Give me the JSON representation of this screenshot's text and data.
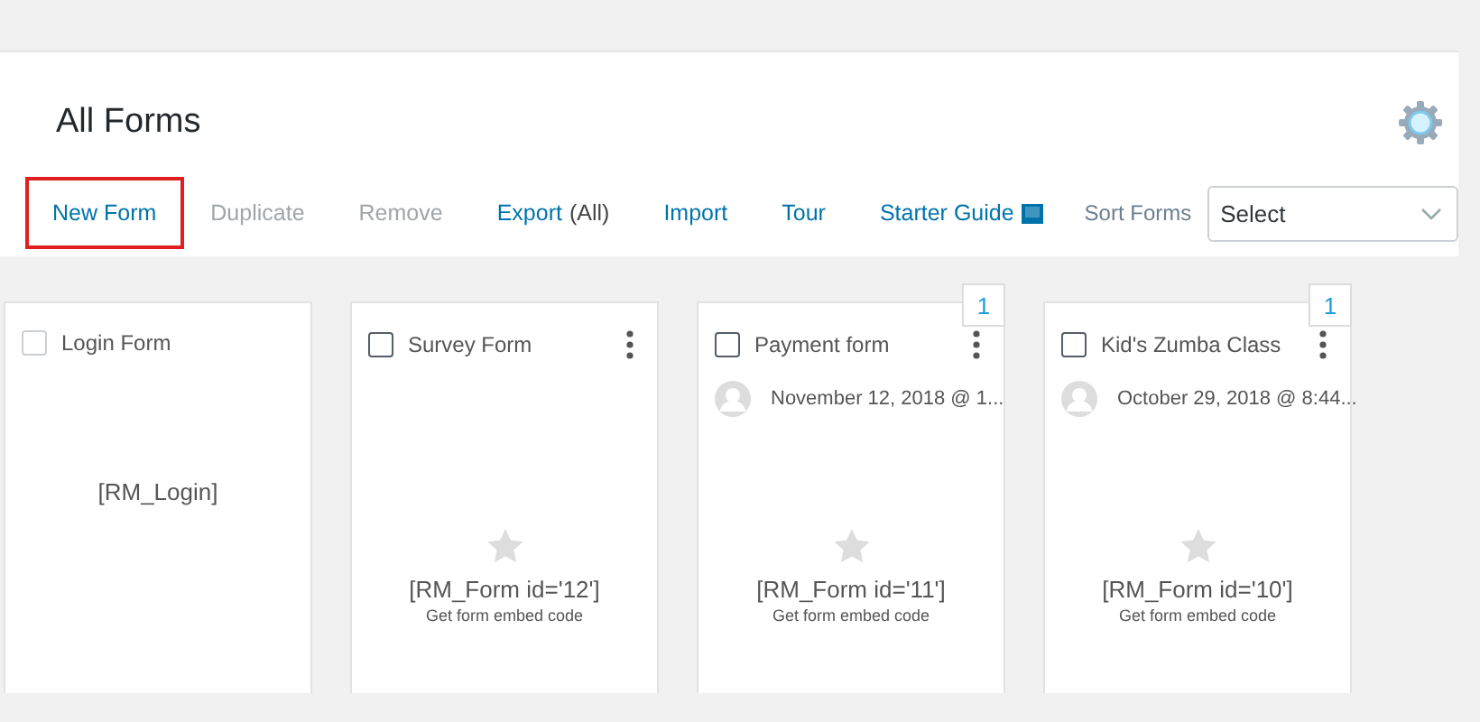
{
  "title": "All Forms",
  "toolbar": [
    {
      "label": "New Form",
      "disabled": false,
      "highlighted": true
    },
    {
      "label": "Duplicate",
      "disabled": true,
      "highlighted": false
    },
    {
      "label": "Remove",
      "disabled": true,
      "highlighted": false
    },
    {
      "label": "Export",
      "suffix": "(All)",
      "disabled": false,
      "highlighted": false
    },
    {
      "label": "Import",
      "disabled": false,
      "highlighted": false
    },
    {
      "label": "Tour",
      "disabled": false,
      "highlighted": false
    },
    {
      "label": "Starter Guide",
      "book_icon": true,
      "disabled": false,
      "highlighted": false
    }
  ],
  "sort": {
    "label": "Sort Forms",
    "value": "Select"
  },
  "forms": [
    {
      "kind": "login",
      "name": "Login Form",
      "checked": false,
      "shortcode": "[RM_Login]"
    },
    {
      "kind": "form",
      "name": "Survey Form",
      "checked": false,
      "shortcode": "[RM_Form id='12']",
      "embed_link": "Get form embed code"
    },
    {
      "kind": "form",
      "name": "Payment form",
      "checked": false,
      "badge": "1",
      "date": "November 12, 2018 @ 1...",
      "shortcode": "[RM_Form id='11']",
      "embed_link": "Get form embed code"
    },
    {
      "kind": "form",
      "name": "Kid's Zumba Class",
      "checked": false,
      "badge": "1",
      "date": "October 29, 2018 @ 8:44...",
      "shortcode": "[RM_Form id='10']",
      "embed_link": "Get form embed code"
    }
  ]
}
